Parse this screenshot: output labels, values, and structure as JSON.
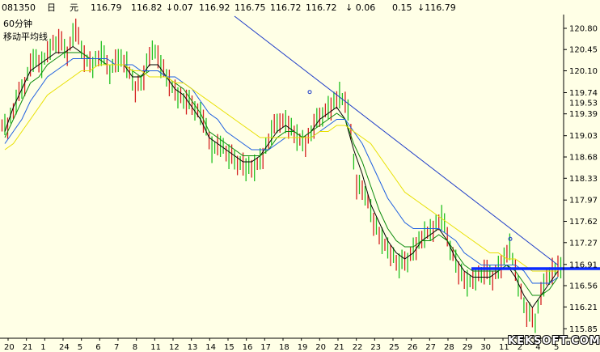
{
  "header": {
    "code": "081350",
    "period_label": "日",
    "currency": "元",
    "open": "116.79",
    "high": "116.82",
    "change": "↓0.07",
    "v1": "116.92",
    "v2": "116.75",
    "v3": "116.72",
    "v4": "116.72",
    "change2": "↓ 0.06",
    "pct": "0.15",
    "last": "↓116.79"
  },
  "panel": {
    "timeframe": "60分钟",
    "indicator": "移动平均线"
  },
  "watermark": "KEKSOFT.COM",
  "chart_data": {
    "type": "line",
    "title": "",
    "y_axis_side": "right",
    "ylim": [
      115.8,
      121.0
    ],
    "y_ticks": [
      120.8,
      120.45,
      120.1,
      119.74,
      119.39,
      119.03,
      118.68,
      118.33,
      117.97,
      117.62,
      117.27,
      116.91,
      116.56,
      116.21,
      115.85
    ],
    "y_current_label": 119.53,
    "x_tick_labels": [
      "20",
      "21",
      "1",
      "24",
      "5",
      "6",
      "7",
      "8",
      "11",
      "12",
      "13",
      "14",
      "15",
      "16",
      "17",
      "18",
      "19",
      "20",
      "21",
      "22",
      "23",
      "25",
      "26",
      "27",
      "28",
      "29",
      "30",
      "11",
      "2",
      "4",
      "5"
    ],
    "series": [
      {
        "style": "price-bars",
        "values": [
          119.2,
          119.6,
          119.9,
          120.3,
          120.2,
          120.5,
          120.6,
          120.4,
          120.8,
          120.3,
          120.2,
          120.4,
          120.1,
          120.3,
          120.2,
          119.8,
          120.0,
          120.5,
          120.2,
          119.9,
          119.7,
          119.6,
          119.5,
          119.3,
          118.8,
          118.9,
          118.7,
          118.6,
          118.5,
          118.5,
          118.7,
          119.1,
          119.3,
          119.2,
          119.0,
          118.9,
          119.2,
          119.4,
          119.5,
          119.7,
          119.5,
          118.2,
          118.1,
          117.6,
          117.3,
          117.1,
          116.9,
          117.0,
          117.2,
          117.4,
          117.5,
          117.7,
          117.2,
          116.8,
          116.6,
          116.7,
          116.8,
          116.7,
          116.9,
          117.2,
          116.6,
          116.1,
          116.0,
          116.6,
          116.8,
          116.9
        ]
      },
      {
        "style": "moving-average",
        "color": "#000000",
        "values": [
          119.1,
          119.5,
          119.8,
          120.1,
          120.2,
          120.3,
          120.4,
          120.4,
          120.5,
          120.4,
          120.3,
          120.3,
          120.2,
          120.2,
          120.2,
          120.0,
          120.0,
          120.2,
          120.2,
          120.0,
          119.8,
          119.7,
          119.5,
          119.3,
          119.0,
          118.9,
          118.8,
          118.7,
          118.6,
          118.6,
          118.7,
          118.9,
          119.1,
          119.2,
          119.1,
          119.0,
          119.1,
          119.3,
          119.4,
          119.5,
          119.3,
          118.8,
          118.4,
          117.9,
          117.6,
          117.3,
          117.1,
          117.0,
          117.1,
          117.3,
          117.4,
          117.5,
          117.3,
          117.0,
          116.8,
          116.7,
          116.7,
          116.7,
          116.8,
          116.9,
          116.7,
          116.4,
          116.2,
          116.4,
          116.6,
          116.8
        ]
      },
      {
        "style": "moving-average",
        "color": "#0a8a0a",
        "values": [
          119.0,
          119.3,
          119.6,
          119.9,
          120.0,
          120.2,
          120.3,
          120.4,
          120.4,
          120.4,
          120.3,
          120.3,
          120.2,
          120.2,
          120.2,
          120.1,
          120.0,
          120.1,
          120.1,
          120.0,
          119.9,
          119.8,
          119.6,
          119.4,
          119.1,
          119.0,
          118.9,
          118.8,
          118.7,
          118.7,
          118.7,
          118.8,
          119.0,
          119.1,
          119.1,
          119.0,
          119.1,
          119.2,
          119.3,
          119.4,
          119.3,
          118.9,
          118.6,
          118.2,
          117.8,
          117.5,
          117.3,
          117.2,
          117.2,
          117.3,
          117.3,
          117.4,
          117.3,
          117.1,
          116.9,
          116.8,
          116.8,
          116.8,
          116.8,
          116.9,
          116.8,
          116.6,
          116.4,
          116.4,
          116.5,
          116.7
        ]
      },
      {
        "style": "moving-average",
        "color": "#1e5fe0",
        "values": [
          118.9,
          119.1,
          119.3,
          119.6,
          119.8,
          120.0,
          120.1,
          120.2,
          120.3,
          120.3,
          120.3,
          120.3,
          120.3,
          120.2,
          120.2,
          120.2,
          120.1,
          120.1,
          120.1,
          120.0,
          120.0,
          119.9,
          119.8,
          119.6,
          119.4,
          119.3,
          119.1,
          119.0,
          118.9,
          118.8,
          118.8,
          118.8,
          118.9,
          119.0,
          119.0,
          119.0,
          119.0,
          119.1,
          119.2,
          119.3,
          119.3,
          119.1,
          118.9,
          118.6,
          118.3,
          118.0,
          117.8,
          117.6,
          117.5,
          117.5,
          117.5,
          117.5,
          117.4,
          117.3,
          117.1,
          117.0,
          116.9,
          116.9,
          116.9,
          116.9,
          116.9,
          116.8,
          116.6,
          116.6,
          116.6,
          116.7
        ]
      },
      {
        "style": "moving-average",
        "color": "#e8e000",
        "values": [
          118.8,
          118.9,
          119.1,
          119.3,
          119.5,
          119.7,
          119.8,
          119.9,
          120.0,
          120.1,
          120.1,
          120.2,
          120.2,
          120.2,
          120.2,
          120.1,
          120.1,
          120.0,
          120.0,
          120.0,
          119.9,
          119.9,
          119.8,
          119.7,
          119.6,
          119.5,
          119.4,
          119.3,
          119.2,
          119.1,
          119.0,
          119.0,
          119.0,
          119.0,
          119.0,
          119.0,
          119.0,
          119.1,
          119.1,
          119.2,
          119.2,
          119.1,
          119.0,
          118.9,
          118.7,
          118.5,
          118.3,
          118.1,
          118.0,
          117.9,
          117.8,
          117.7,
          117.6,
          117.5,
          117.4,
          117.3,
          117.2,
          117.1,
          117.1,
          117.0,
          117.0,
          116.9,
          116.8,
          116.8,
          116.8,
          116.8
        ]
      }
    ],
    "trendline": {
      "from_index": 0,
      "from_value": 121.0,
      "to_index": 65,
      "to_value": 116.9,
      "color": "#1e3cc8"
    },
    "support_line": {
      "value": 116.84,
      "color": "#0b2bff"
    }
  }
}
